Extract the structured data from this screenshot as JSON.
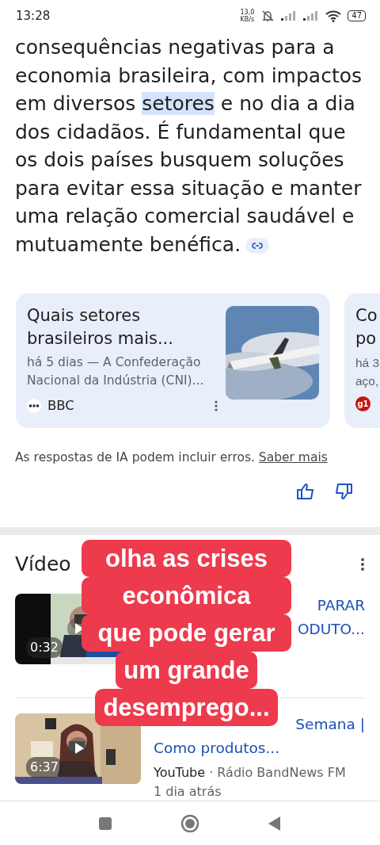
{
  "status_bar": {
    "time": "13:28",
    "net_speed_value": "13,0",
    "net_speed_unit": "KB/s",
    "battery": "47"
  },
  "answer": {
    "before": "consequências negativas para a economia brasileira, com impactos em diversos ",
    "highlight": "setores",
    "after": " e no dia a dia dos cidadãos. É fundamental que os dois países busquem soluções para evitar essa situação e manter uma relação comercial saudável e mutuamente benéfica."
  },
  "sources": [
    {
      "title_lines": [
        "Quais setores",
        "brasileiros mais..."
      ],
      "snippet_lines": [
        "há 5 dias — A Confederação",
        "Nacional da Indústria (CNI)..."
      ],
      "source": "BBC",
      "kind": "full"
    },
    {
      "title_lines": [
        "Co",
        "po"
      ],
      "snippet_lines": [
        "há 3",
        "aço,"
      ],
      "logo_text": "g1",
      "kind": "cut"
    }
  ],
  "disclaimer": {
    "text": "As respostas de IA podem incluir erros.",
    "link": "Saber mais"
  },
  "videos_heading": "Vídeo",
  "videos": [
    {
      "duration": "0:32",
      "title_lines": [
        "PARAR",
        "ODUTO..."
      ]
    },
    {
      "duration": "6:37",
      "title_lines": [
        "Semana |",
        "Como produtos..."
      ],
      "site": "YouTube",
      "channel": " · Rádio BandNews FM",
      "when": "1 dia atrás"
    }
  ],
  "caption": [
    "olha as crises",
    "econômica",
    "que pode gerar",
    "um grande",
    "desemprego..."
  ]
}
